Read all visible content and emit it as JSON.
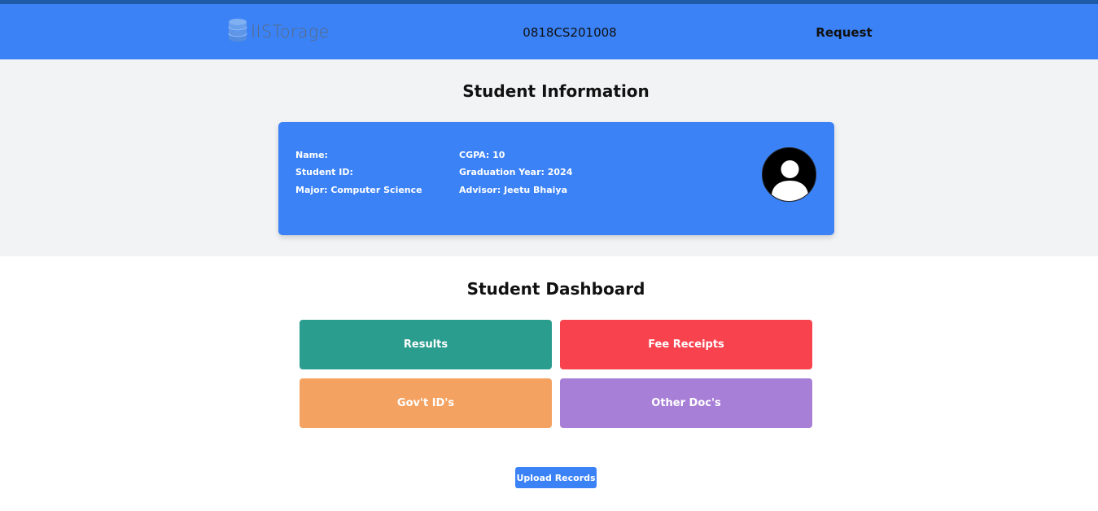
{
  "header": {
    "logo_text": "IISTorage",
    "student_id": "0818CS201008",
    "request_label": "Request"
  },
  "info": {
    "title": "Student Information",
    "name": "Name:",
    "student_id": "Student ID:",
    "major": "Major: Computer Science",
    "cgpa": "CGPA: 10",
    "graduation_year": "Graduation Year: 2024",
    "advisor": "Advisor: Jeetu Bhaiya"
  },
  "dashboard": {
    "title": "Student Dashboard",
    "tiles": [
      {
        "label": "Results",
        "color": "#2a9d8f"
      },
      {
        "label": "Fee Receipts",
        "color": "#f8434f"
      },
      {
        "label": "Gov't ID's",
        "color": "#f4a261"
      },
      {
        "label": "Other Doc's",
        "color": "#a87fd6"
      }
    ],
    "upload_label": "Upload Records"
  },
  "colors": {
    "primary": "#3b82f6",
    "top_strip": "#1e5aa8",
    "info_bg": "#f2f3f5"
  },
  "icons": {
    "logo": "database-icon",
    "avatar": "user-silhouette-icon"
  }
}
